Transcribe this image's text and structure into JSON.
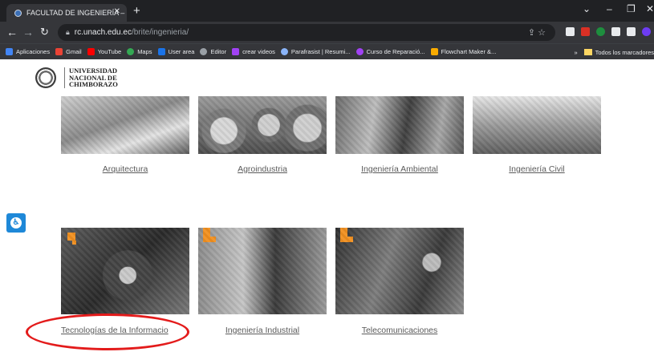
{
  "browser": {
    "tab": {
      "title": "FACULTAD DE INGENIERÍA – Rec"
    },
    "address": {
      "host": "rc.unach.edu.ec",
      "path": "/brite/ingenieria/"
    },
    "bookmarks": [
      {
        "label": "Aplicaciones",
        "color": "#4285f4"
      },
      {
        "label": "Gmail",
        "color": "#ea4335"
      },
      {
        "label": "YouTube",
        "color": "#ff0000"
      },
      {
        "label": "Maps",
        "color": "#34a853"
      },
      {
        "label": "User area",
        "color": "#1a73e8"
      },
      {
        "label": "Editor",
        "color": "#9aa0a6"
      },
      {
        "label": "crear videos",
        "color": "#a142f4"
      },
      {
        "label": "Parafrasist | Resumi...",
        "color": "#8ab4f8"
      },
      {
        "label": "Curso de Reparació...",
        "color": "#a142f4"
      },
      {
        "label": "Flowchart Maker &...",
        "color": "#f9ab00"
      }
    ],
    "bookmarks_more": "»",
    "bookmarks_all": "Todos los marcadores"
  },
  "site": {
    "logo_lines": [
      "UNIVERSIDAD",
      "NACIONAL DE",
      "CHIMBORAZO"
    ]
  },
  "programs": [
    {
      "label": "Arquitectura",
      "icon": "architecture-photo"
    },
    {
      "label": "Agroindustria",
      "icon": "agroindustry-photo"
    },
    {
      "label": "Ingeniería Ambiental",
      "icon": "environmental-photo"
    },
    {
      "label": "Ingeniería Civil",
      "icon": "civil-photo"
    },
    {
      "label": "Tecnologías de la Informacio",
      "icon": "it-photo"
    },
    {
      "label": "Ingeniería Industrial",
      "icon": "industrial-photo"
    },
    {
      "label": "Telecomunicaciones",
      "icon": "telecom-photo"
    }
  ],
  "colors": {
    "accent": "#f29020",
    "annotation": "#e31b1b",
    "a11y": "#1e88d8"
  }
}
